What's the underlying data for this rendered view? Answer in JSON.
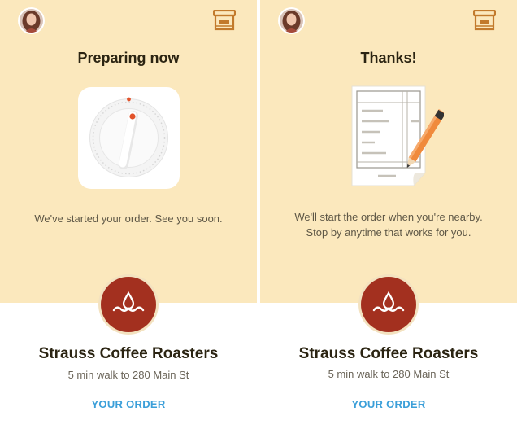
{
  "screens": [
    {
      "title": "Preparing now",
      "message_lines": [
        "We've started your order. See you soon."
      ],
      "illustration_icon": "timer-dial-icon",
      "shop": {
        "name": "Strauss Coffee Roasters",
        "distance": "5 min walk to 280 Main St",
        "order_link": "YOUR ORDER",
        "logo_icon": "drop-wave-logo-icon"
      }
    },
    {
      "title": "Thanks!",
      "message_lines": [
        "We'll start the order when you're nearby.",
        "Stop by anytime that works for you."
      ],
      "illustration_icon": "receipt-pencil-icon",
      "shop": {
        "name": "Strauss Coffee Roasters",
        "distance": "5 min walk to 280 Main St",
        "order_link": "YOUR ORDER",
        "logo_icon": "drop-wave-logo-icon"
      }
    }
  ],
  "colors": {
    "header_background": "#fbe8bd",
    "brand_logo": "#a3301f",
    "link": "#3b9fd9",
    "store_icon": "#c27a2c",
    "timer_accent": "#e2532b"
  },
  "icons": {
    "avatar": "user-avatar-icon",
    "store": "store-icon"
  }
}
